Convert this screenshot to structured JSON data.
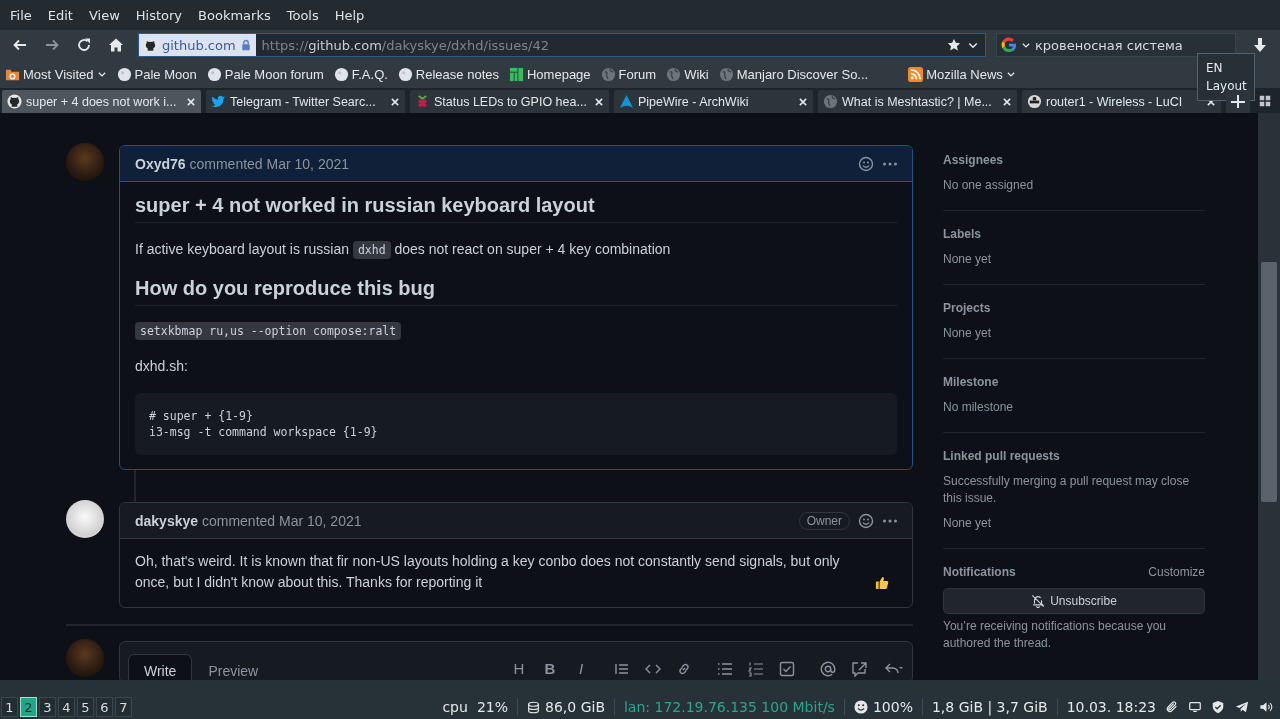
{
  "menu": [
    "File",
    "Edit",
    "View",
    "History",
    "Bookmarks",
    "Tools",
    "Help"
  ],
  "address": {
    "site": "github.com",
    "scheme": "https://",
    "host": "github.com",
    "path": "/dakyskye/dxhd/issues/42"
  },
  "search": {
    "value": "кровеносная система"
  },
  "tooltip": {
    "lines": [
      "EN",
      "Layout"
    ]
  },
  "bookmarks": [
    {
      "label": "Most Visited",
      "kind": "folder",
      "dropdown": true
    },
    {
      "label": "Pale Moon",
      "kind": "moon",
      "dropdown": false
    },
    {
      "label": "Pale Moon forum",
      "kind": "moon",
      "dropdown": false
    },
    {
      "label": "F.A.Q.",
      "kind": "moon",
      "dropdown": false
    },
    {
      "label": "Release notes",
      "kind": "moon",
      "dropdown": false
    },
    {
      "label": "Homepage",
      "kind": "manjaro",
      "dropdown": false
    },
    {
      "label": "Forum",
      "kind": "globe",
      "dropdown": false
    },
    {
      "label": "Wiki",
      "kind": "globe",
      "dropdown": false
    },
    {
      "label": "Manjaro Discover So...",
      "kind": "globe",
      "dropdown": false
    },
    {
      "label": "Mozilla News",
      "kind": "rss",
      "dropdown": true
    }
  ],
  "tabs": [
    {
      "title": "super + 4 does not work i...",
      "kind": "github",
      "selected": true
    },
    {
      "title": "Telegram - Twitter Searc...",
      "kind": "bird",
      "selected": false
    },
    {
      "title": "Status LEDs to GPIO hea...",
      "kind": "berry",
      "selected": false
    },
    {
      "title": "PipeWire - ArchWiki",
      "kind": "arch",
      "selected": false
    },
    {
      "title": "What is Meshtastic? | Me...",
      "kind": "globe",
      "selected": false
    },
    {
      "title": "router1 - Wireless - LuCI",
      "kind": "router",
      "selected": false
    }
  ],
  "comments": [
    {
      "author": "Oxyd76",
      "action": "commented",
      "date": "Mar 10, 2021",
      "highlighted": true,
      "blocks": [
        {
          "kind": "heading",
          "text": "super + 4 not worked in russian keyboard layout"
        },
        {
          "kind": "paragraph",
          "parts": [
            {
              "kind": "text",
              "text": "If active keyboard layout is russian "
            },
            {
              "kind": "code",
              "text": "dxhd"
            },
            {
              "kind": "text",
              "text": " does not react on super + 4 key combination"
            }
          ]
        },
        {
          "kind": "heading",
          "text": "How do you reproduce this bug"
        },
        {
          "kind": "code",
          "text": "setxkbmap ru,us --option compose:ralt"
        },
        {
          "kind": "paragraph",
          "parts": [
            {
              "kind": "text",
              "text": "dxhd.sh:"
            }
          ]
        },
        {
          "kind": "pre",
          "lines": [
            "# super + {1-9}",
            "i3-msg -t command workspace {1-9}"
          ]
        }
      ]
    },
    {
      "author": "dakyskye",
      "action": "commented",
      "date": "Mar 10, 2021",
      "badge": "Owner",
      "highlighted": false,
      "blocks": [
        {
          "kind": "paragraph",
          "parts": [
            {
              "kind": "text",
              "text": "Oh, that's weird. It is known that fir non-US layouts holding a key conbo does not constantly send signals, but only once, but I didn't know about this. Thanks for reporting it"
            },
            {
              "kind": "thumbs_up"
            }
          ]
        }
      ]
    }
  ],
  "editor": {
    "tabs": [
      {
        "label": "Write",
        "selected": true
      },
      {
        "label": "Preview",
        "selected": false
      }
    ],
    "tools": [
      {
        "kind": "heading",
        "text": "H"
      },
      {
        "kind": "bold",
        "text": "B"
      },
      {
        "kind": "italic",
        "text": "I"
      },
      {
        "kind": "quote"
      },
      {
        "kind": "code"
      },
      {
        "kind": "link"
      },
      {
        "kind": "ulist"
      },
      {
        "kind": "olist"
      },
      {
        "kind": "task"
      },
      {
        "kind": "mention"
      },
      {
        "kind": "reference"
      },
      {
        "kind": "reply"
      }
    ]
  },
  "sidebar": [
    {
      "title": "Assignees",
      "lines": [
        "No one assigned"
      ]
    },
    {
      "title": "Labels",
      "lines": [
        "None yet"
      ]
    },
    {
      "title": "Projects",
      "lines": [
        "None yet"
      ]
    },
    {
      "title": "Milestone",
      "lines": [
        "No milestone"
      ]
    },
    {
      "title": "Linked pull requests",
      "lines": [
        "Successfully merging a pull request may close this issue.",
        "None yet"
      ]
    }
  ],
  "notifications": {
    "title": "Notifications",
    "link": "Customize",
    "button": "Unsubscribe",
    "note": "You’re receiving notifications because you authored the thread."
  },
  "taskbar": {
    "workspaces": [
      {
        "label": "1",
        "selected": false
      },
      {
        "label": "2",
        "selected": true
      },
      {
        "label": "3",
        "selected": false
      },
      {
        "label": "4",
        "selected": false
      },
      {
        "label": "5",
        "selected": false
      },
      {
        "label": "6",
        "selected": false
      },
      {
        "label": "7",
        "selected": false
      }
    ],
    "cpu_label": "cpu",
    "cpu": "21%",
    "disk": "86,0 GiB",
    "lan": "lan: 172.19.76.135 100 Mbit/s",
    "battery": "100%",
    "memory": "1,8 GiB | 3,7 GiB",
    "clock": "10.03. 18:23"
  }
}
